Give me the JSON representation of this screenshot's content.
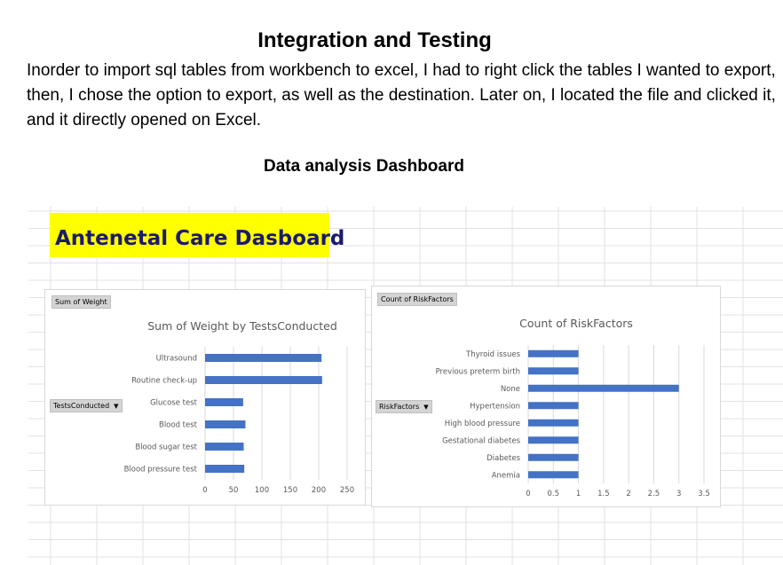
{
  "document": {
    "title": "Integration and Testing",
    "paragraph": "Inorder to import sql tables from workbench to excel, I had to right click the tables I wanted to export, then, I chose the option to export, as well as the destination. Later on, I located the file and clicked it, and it directly opened on Excel.",
    "subtitle": "Data analysis Dashboard"
  },
  "dashboard": {
    "banner_title": "Antenetal Care Dasboard",
    "banner_color": "#ffff00",
    "bar_color": "#4472c4"
  },
  "chart1": {
    "value_button": "Sum of Weight",
    "axis_button": "TestsConducted"
  },
  "chart2": {
    "value_button": "Count of RiskFactors",
    "axis_button": "RiskFactors"
  },
  "chart_data": [
    {
      "type": "bar",
      "orientation": "horizontal",
      "title": "Sum of Weight by TestsConducted",
      "categories": [
        "Ultrasound",
        "Routine check-up",
        "Glucose test",
        "Blood test",
        "Blood sugar test",
        "Blood pressure test"
      ],
      "values": [
        205,
        206,
        67,
        71,
        68,
        69
      ],
      "xlim": [
        0,
        250
      ],
      "xticks": [
        "0",
        "50",
        "100",
        "150",
        "200",
        "250"
      ],
      "grid": true,
      "legend": "none"
    },
    {
      "type": "bar",
      "orientation": "horizontal",
      "title": "Count of RiskFactors",
      "categories": [
        "Thyroid issues",
        "Previous preterm birth",
        "None",
        "Hypertension",
        "High blood pressure",
        "Gestational diabetes",
        "Diabetes",
        "Anemia"
      ],
      "values": [
        1,
        1,
        3,
        1,
        1,
        1,
        1,
        1
      ],
      "xlim": [
        0,
        3.5
      ],
      "xticks": [
        "0",
        "0.5",
        "1",
        "1.5",
        "2",
        "2.5",
        "3",
        "3.5"
      ],
      "grid": true,
      "legend": "none"
    }
  ]
}
